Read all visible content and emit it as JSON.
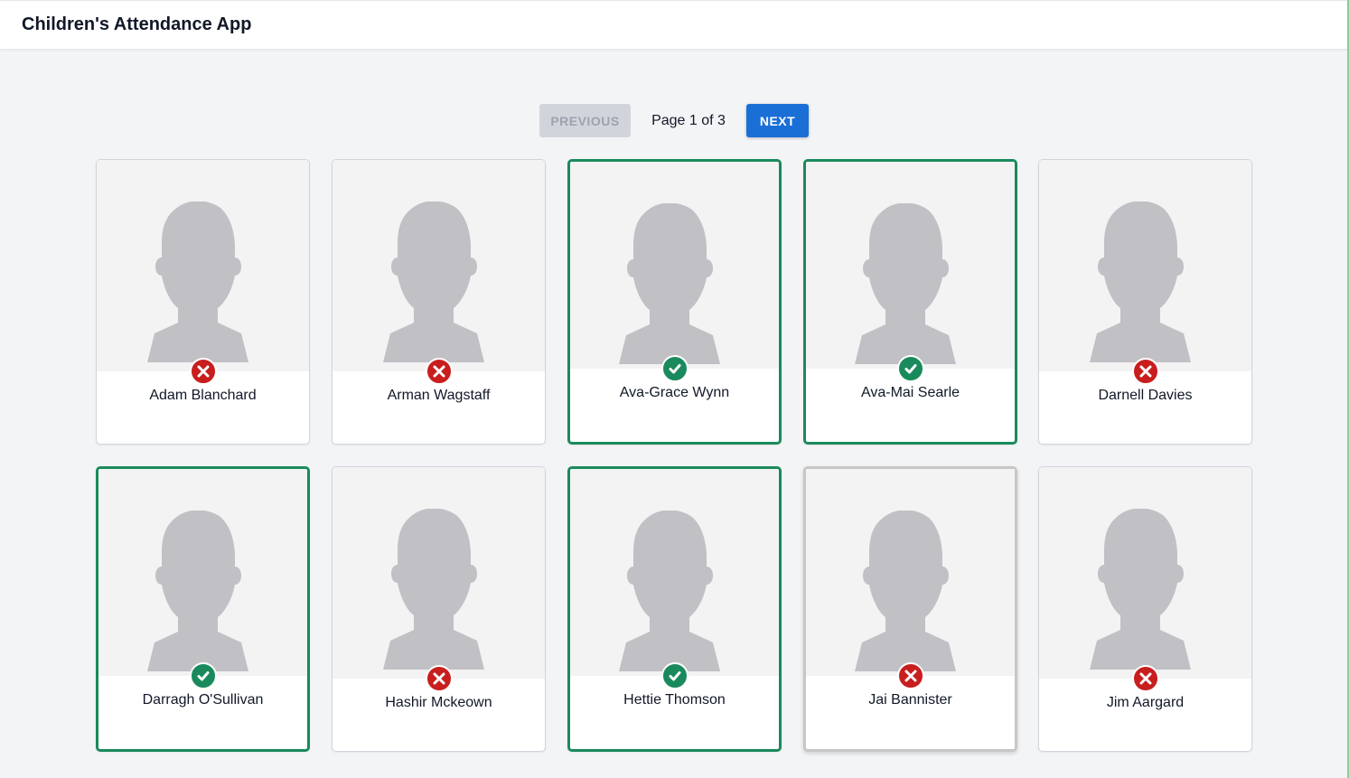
{
  "app": {
    "title": "Children's Attendance App"
  },
  "pagination": {
    "previous_label": "PREVIOUS",
    "next_label": "NEXT",
    "page_info": "Page 1 of 3"
  },
  "colors": {
    "present": "#1a8a5c",
    "absent": "#c81e1e",
    "next_button": "#1a6fd6"
  },
  "children": [
    {
      "name": "Adam Blanchard",
      "status": "absent",
      "status_icon": "cross-icon"
    },
    {
      "name": "Arman Wagstaff",
      "status": "absent",
      "status_icon": "cross-icon"
    },
    {
      "name": "Ava-Grace Wynn",
      "status": "present",
      "status_icon": "check-icon"
    },
    {
      "name": "Ava-Mai Searle",
      "status": "present",
      "status_icon": "check-icon"
    },
    {
      "name": "Darnell Davies",
      "status": "absent",
      "status_icon": "cross-icon"
    },
    {
      "name": "Darragh O'Sullivan",
      "status": "present",
      "status_icon": "check-icon"
    },
    {
      "name": "Hashir Mckeown",
      "status": "absent",
      "status_icon": "cross-icon"
    },
    {
      "name": "Hettie Thomson",
      "status": "present",
      "status_icon": "check-icon"
    },
    {
      "name": "Jai Bannister",
      "status": "absent",
      "status_icon": "cross-icon"
    },
    {
      "name": "Jim Aargard",
      "status": "absent",
      "status_icon": "cross-icon"
    }
  ]
}
